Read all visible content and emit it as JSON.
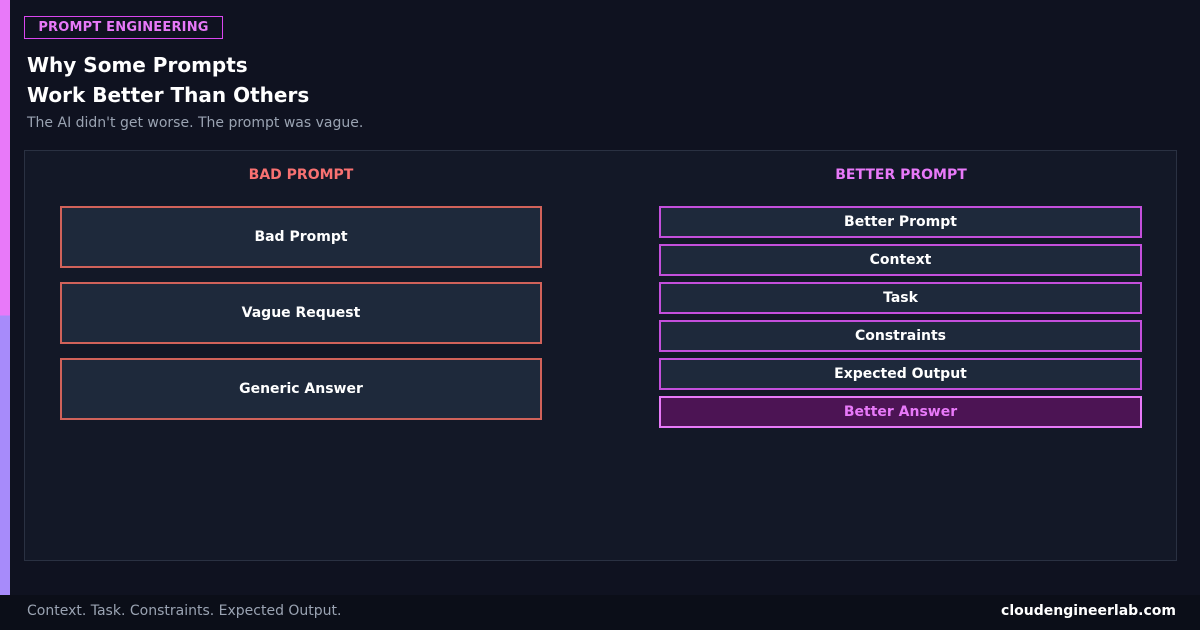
{
  "tag": "PROMPT ENGINEERING",
  "title": {
    "line1": "Why Some Prompts",
    "line2": "Work Better Than Others"
  },
  "subtitle": "The AI didn't get worse. The prompt was vague.",
  "bad_column": {
    "heading": "BAD PROMPT",
    "items": [
      "Bad Prompt",
      "Vague Request",
      "Generic Answer"
    ]
  },
  "better_column": {
    "heading": "BETTER PROMPT",
    "items": [
      "Better Prompt",
      "Context",
      "Task",
      "Constraints",
      "Expected Output",
      "Better Answer"
    ]
  },
  "footer": {
    "tagline": "Context. Task. Constraints. Expected Output.",
    "site": "cloudengineerlab.com"
  },
  "colors": {
    "accent_magenta": "#e879f9",
    "accent_violet": "#a78bfa",
    "bad_red": "#f87171",
    "background": "#0f1220"
  }
}
